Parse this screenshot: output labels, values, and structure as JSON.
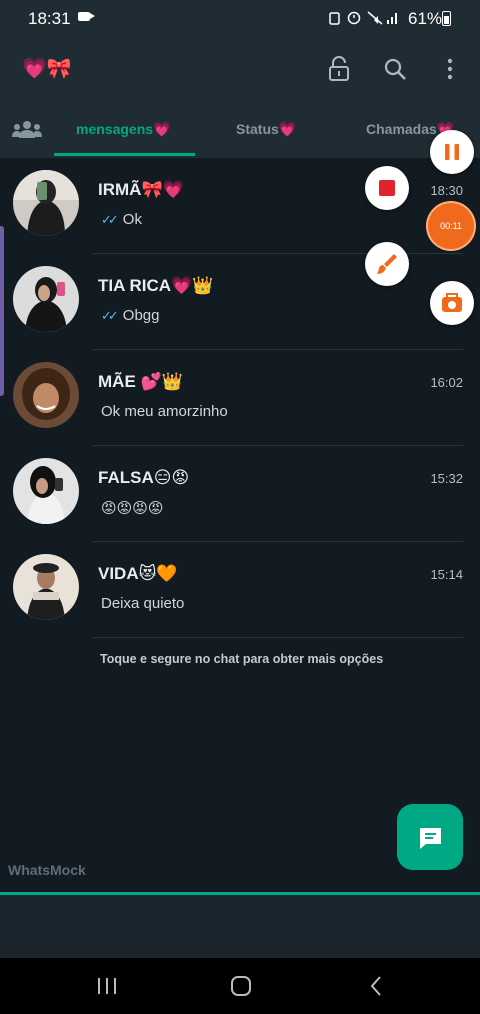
{
  "status_bar": {
    "time": "18:31",
    "battery_pct": "61%",
    "icons": [
      "alarm-icon",
      "mute-icon",
      "signal-icon"
    ]
  },
  "app": {
    "title": "💗🎀"
  },
  "tabs": [
    {
      "label": "mensagens💗",
      "active": true
    },
    {
      "label": "Status💗",
      "active": false
    },
    {
      "label": "Chamadas💗",
      "active": false
    }
  ],
  "chats": [
    {
      "name": "IRMÃ🎀💗",
      "message": "Ok",
      "time": "18:30",
      "read_ticks": true
    },
    {
      "name": "TIA RICA💗👑",
      "message": "Obgg",
      "time": "",
      "read_ticks": true
    },
    {
      "name": "MÃE 💕👑",
      "message": "Ok meu amorzinho",
      "time": "16:02",
      "read_ticks": false
    },
    {
      "name": "FALSA😑😡",
      "message": "😡😡😡😡",
      "time": "15:32",
      "read_ticks": false
    },
    {
      "name": "VIDA😻🧡",
      "message": "Deixa quieto",
      "time": "15:14",
      "read_ticks": false
    }
  ],
  "hint": "Toque e segure no chat para obter mais opções",
  "watermark": "WhatsMock",
  "recorder": {
    "timer": "00:11"
  },
  "colors": {
    "accent": "#00a884",
    "background": "#121b22",
    "bar": "#1f2c34",
    "ticks": "#53bdeb",
    "recorder": "#f06a1e"
  }
}
